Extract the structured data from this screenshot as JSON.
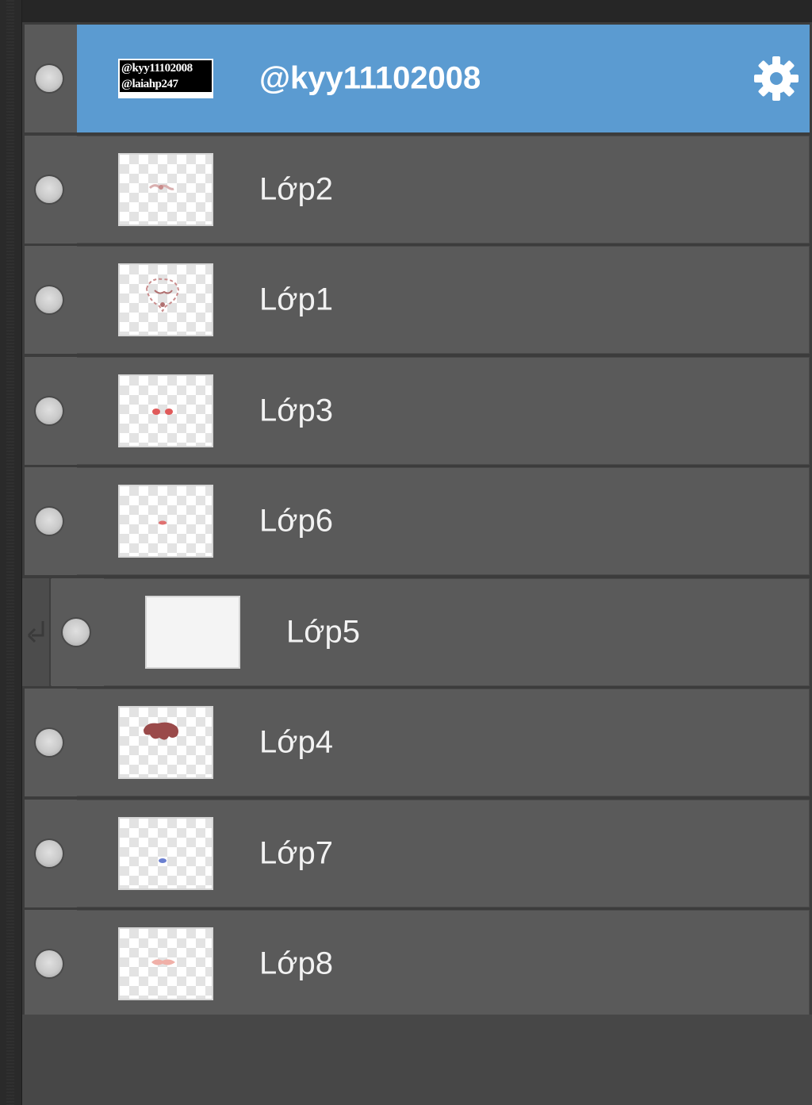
{
  "layers_panel": {
    "layers": [
      {
        "name": "@kyy11102008",
        "selected": true,
        "thumb_lines": [
          "@kyy11102008",
          "@laiahp247"
        ],
        "visible": true
      },
      {
        "name": "Lớp2",
        "visible": true,
        "thumb_mark_color": "#d9b0b0"
      },
      {
        "name": "Lớp1",
        "visible": true,
        "thumb_mark_color": "#c98c8c"
      },
      {
        "name": "Lớp3",
        "visible": true,
        "thumb_mark_color": "#e05a5a"
      },
      {
        "name": "Lớp6",
        "visible": true,
        "thumb_mark_color": "#e07070"
      },
      {
        "name": "Lớp5",
        "visible": true,
        "clipped": true,
        "thumb_mark_color": "#ffffff"
      },
      {
        "name": "Lớp4",
        "visible": true,
        "thumb_mark_color": "#9a4a4a"
      },
      {
        "name": "Lớp7",
        "visible": true,
        "thumb_mark_color": "#6a7fd0"
      },
      {
        "name": "Lớp8",
        "visible": true,
        "thumb_mark_color": "#f0b0a8"
      }
    ],
    "icons": {
      "visibility": "eye-dot-icon",
      "settings": "gear-icon",
      "clipping": "clip-arrow-icon"
    },
    "colors": {
      "selected_bg": "#5b9bd1",
      "row_bg": "#5a5a5a",
      "panel_bg": "#3c3c3c"
    }
  }
}
